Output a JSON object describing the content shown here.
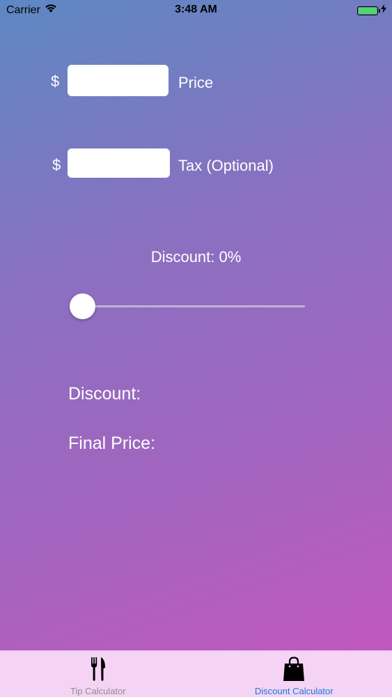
{
  "status_bar": {
    "carrier": "Carrier",
    "time": "3:48 AM"
  },
  "form": {
    "currency_symbol": "$",
    "price": {
      "value": "",
      "label": "Price"
    },
    "tax": {
      "value": "",
      "label": "Tax (Optional)"
    }
  },
  "discount_slider": {
    "header": "Discount:  0%",
    "value": 0
  },
  "results": {
    "discount_label": "Discount:",
    "final_price_label": "Final Price:"
  },
  "tab_bar": {
    "tabs": [
      {
        "label": "Tip Calculator",
        "icon": "fork-knife-icon",
        "active": false
      },
      {
        "label": "Discount Calculator",
        "icon": "shopping-bag-icon",
        "active": true
      }
    ]
  },
  "colors": {
    "gradient_start": "#5d88c3",
    "gradient_end": "#c756bf",
    "tab_bar_bg": "#f5d3f5",
    "active_tab": "#1a7bd6",
    "inactive_tab": "#8e8e93",
    "battery_fill": "#4cd964"
  }
}
